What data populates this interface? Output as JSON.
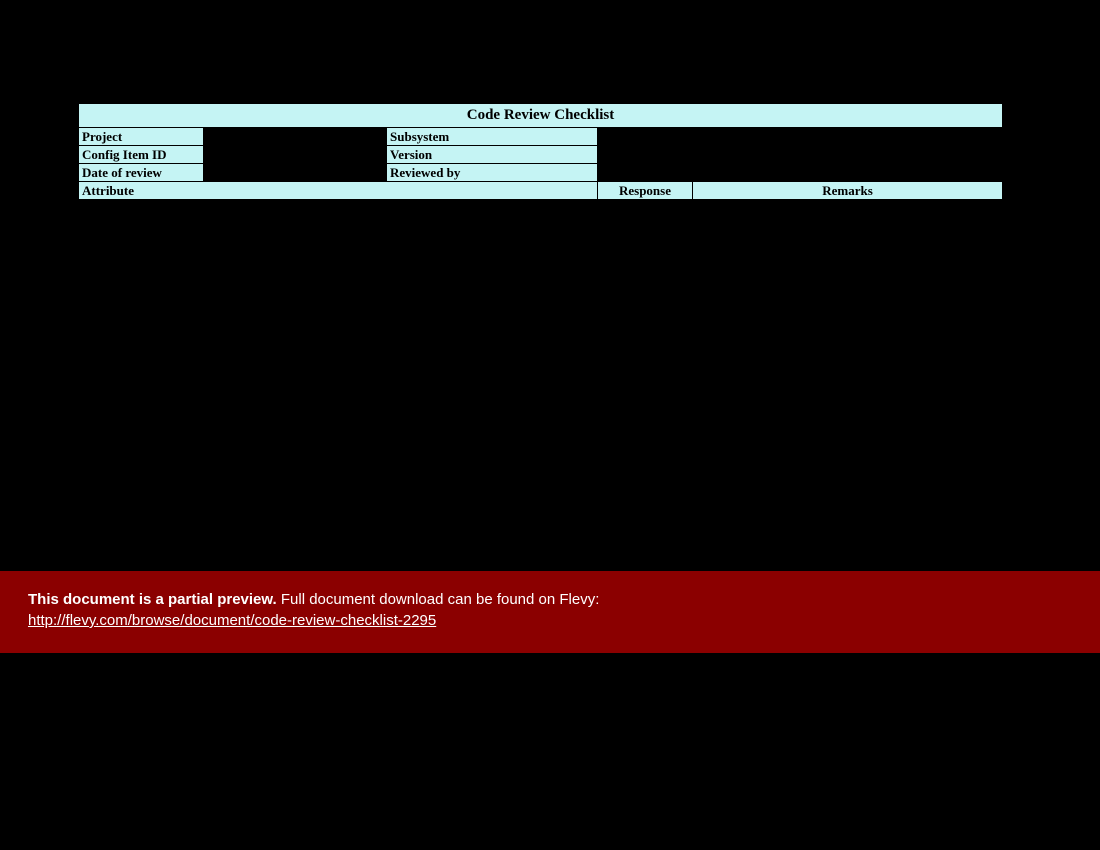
{
  "title": "Code Review Checklist",
  "metaRows": [
    {
      "label1": "Project",
      "label2": "Subsystem"
    },
    {
      "label1": "Config Item ID",
      "label2": "Version"
    },
    {
      "label1": "Date of review",
      "label2": "Reviewed by"
    }
  ],
  "columns": {
    "attribute": "Attribute",
    "response": "Response",
    "remarks": "Remarks"
  },
  "banner": {
    "strong": "This document is a partial preview.",
    "rest": "  Full document download can be found on Flevy:",
    "link": "http://flevy.com/browse/document/code-review-checklist-2295"
  }
}
